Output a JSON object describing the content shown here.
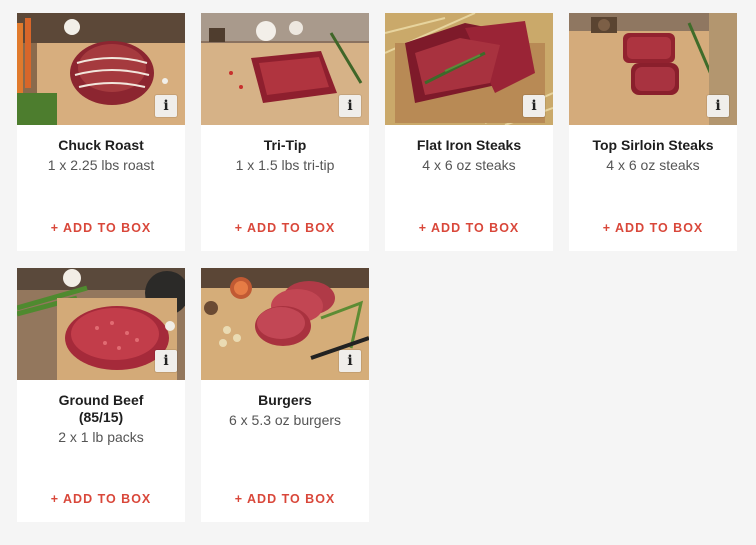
{
  "products": [
    {
      "name": "Chuck Roast",
      "detail": "1 x 2.25 lbs roast",
      "action": "+ ADD TO BOX",
      "info": "i",
      "image": "chuck-roast-photo"
    },
    {
      "name": "Tri-Tip",
      "detail": "1 x 1.5 lbs tri-tip",
      "action": "+ ADD TO BOX",
      "info": "i",
      "image": "tri-tip-photo"
    },
    {
      "name": "Flat Iron Steaks",
      "detail": "4 x 6 oz steaks",
      "action": "+ ADD TO BOX",
      "info": "i",
      "image": "flat-iron-steaks-photo"
    },
    {
      "name": "Top Sirloin Steaks",
      "detail": "4 x 6 oz steaks",
      "action": "+ ADD TO BOX",
      "info": "i",
      "image": "top-sirloin-steaks-photo"
    },
    {
      "name": "Ground Beef (85/15)",
      "detail": "2 x 1 lb packs",
      "action": "+ ADD TO BOX",
      "info": "i",
      "image": "ground-beef-photo"
    },
    {
      "name": "Burgers",
      "detail": "6 x 5.3 oz burgers",
      "action": "+ ADD TO BOX",
      "info": "i",
      "image": "burgers-photo"
    }
  ],
  "colors": {
    "accent": "#d9473a",
    "background": "#f5f5f5",
    "card": "#ffffff"
  }
}
